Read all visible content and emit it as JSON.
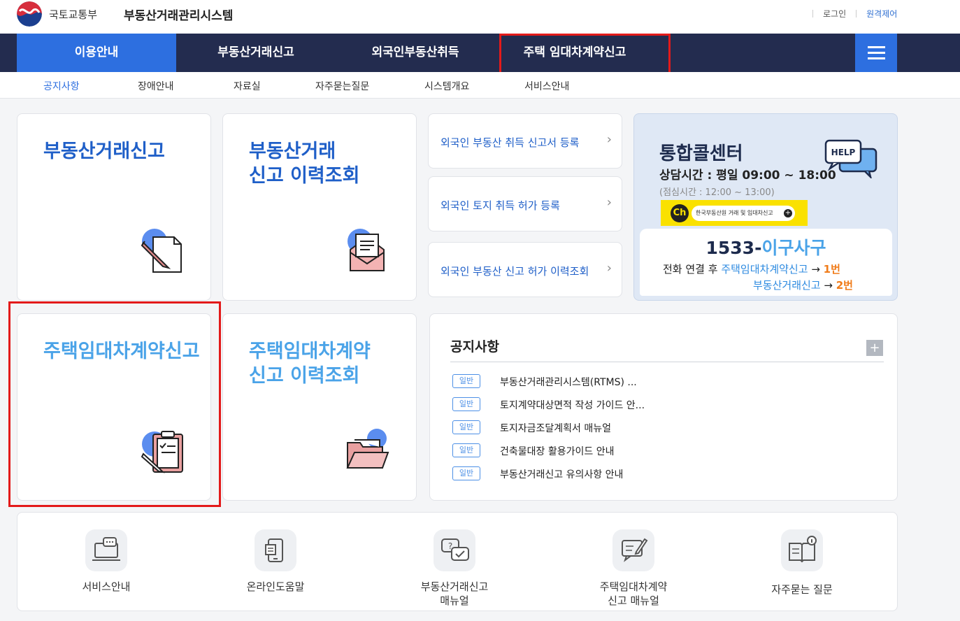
{
  "header": {
    "ministry": "국토교통부",
    "system_name": "부동산거래관리시스템",
    "login": "로그인",
    "remote_control": "원격제어"
  },
  "main_nav": [
    {
      "label": "이용안내",
      "active": true
    },
    {
      "label": "부동산거래신고",
      "active": false
    },
    {
      "label": "외국인부동산취득",
      "active": false
    },
    {
      "label": "주택 임대차계약신고",
      "active": false
    }
  ],
  "sub_nav": [
    {
      "label": "공지사항",
      "active": true
    },
    {
      "label": "장애안내",
      "active": false
    },
    {
      "label": "자료실",
      "active": false
    },
    {
      "label": "자주묻는질문",
      "active": false
    },
    {
      "label": "시스템개요",
      "active": false
    },
    {
      "label": "서비스안내",
      "active": false
    }
  ],
  "cards": {
    "real_estate_report": {
      "line1": "부동산거래신고"
    },
    "real_estate_history": {
      "line1": "부동산거래",
      "line2": "신고 이력조회"
    },
    "housing_lease_report": {
      "line1": "주택임대차계약신고"
    },
    "housing_lease_history": {
      "line1": "주택임대차계약",
      "line2": "신고 이력조회"
    }
  },
  "foreigner_links": [
    {
      "label": "외국인 부동산 취득 신고서 등록",
      "chevron": "›"
    },
    {
      "label": "외국인 토지 취득 허가 등록",
      "chevron": "›"
    },
    {
      "label": "외국인 부동산 신고 허가 이력조회",
      "chevron": "›"
    }
  ],
  "call_center": {
    "title": "통합콜센터",
    "hours": "상담시간 : 평일 09:00 ~ 18:00",
    "lunch": "(점심시간 : 12:00 ~ 13:00)",
    "help_bubble": "HELP",
    "kakao_ch": "Ch",
    "kakao_text": "한국부동산원 거래 및 임대차신고",
    "kakao_plus": "+",
    "phone_part1": "1533-",
    "phone_part2": "이구사구",
    "line1_prefix": "전화 연결 후",
    "line1_target": "주택임대차계약신고",
    "line1_arrow": "→",
    "line1_num": "1번",
    "line2_target": "부동산거래신고",
    "line2_arrow": "→",
    "line2_num": "2번"
  },
  "notice": {
    "title": "공지사항",
    "more": "+",
    "items": [
      {
        "badge": "일반",
        "text": "부동산거래관리시스템(RTMS) ..."
      },
      {
        "badge": "일반",
        "text": "토지계약대상면적 작성 가이드 안..."
      },
      {
        "badge": "일반",
        "text": "토지자금조달계획서 매뉴얼"
      },
      {
        "badge": "일반",
        "text": "건축물대장 활용가이드 안내"
      },
      {
        "badge": "일반",
        "text": "부동산거래신고 유의사항 안내"
      }
    ]
  },
  "bottom_links": [
    {
      "line1": "서비스안내",
      "line2": "",
      "icon": "laptop-chat-icon"
    },
    {
      "line1": "온라인도움말",
      "line2": "",
      "icon": "mobile-doc-icon"
    },
    {
      "line1": "부동산거래신고",
      "line2": "매뉴얼",
      "icon": "question-bubble-icon"
    },
    {
      "line1": "주택임대차계약",
      "line2": "신고 매뉴얼",
      "icon": "edit-bubble-icon"
    },
    {
      "line1": "자주묻는 질문",
      "line2": "",
      "icon": "book-info-icon"
    }
  ],
  "colors": {
    "nav_bg": "#232c4f",
    "accent_blue": "#2d6fe0",
    "highlight_red": "#e31a1a",
    "orange": "#f07c1a"
  }
}
